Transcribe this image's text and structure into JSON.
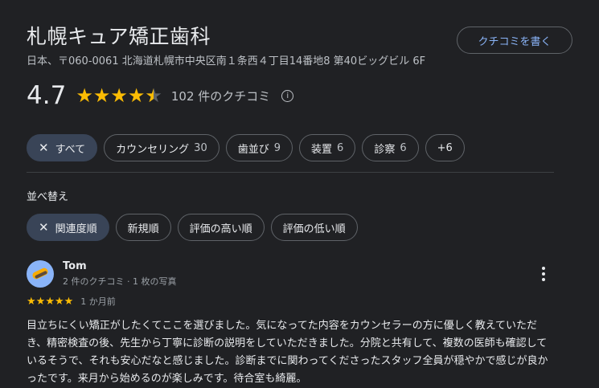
{
  "place": {
    "name": "札幌キュア矯正歯科",
    "address": "日本、〒060-0061 北海道札幌市中央区南１条西４丁目14番地8 第40ビッグビル 6F",
    "write_review_label": "クチコミを書く"
  },
  "summary": {
    "rating": "4.7",
    "stars_value": 4.7,
    "review_count_label": "102 件のクチコミ"
  },
  "filters": [
    {
      "label": "すべて",
      "count": "",
      "active": true
    },
    {
      "label": "カウンセリング",
      "count": "30",
      "active": false
    },
    {
      "label": "歯並び",
      "count": "9",
      "active": false
    },
    {
      "label": "装置",
      "count": "6",
      "active": false
    },
    {
      "label": "診察",
      "count": "6",
      "active": false
    },
    {
      "label": "+6",
      "count": "",
      "active": false
    }
  ],
  "sort": {
    "label": "並べ替え",
    "options": [
      {
        "label": "関連度順",
        "active": true
      },
      {
        "label": "新規順",
        "active": false
      },
      {
        "label": "評価の高い順",
        "active": false
      },
      {
        "label": "評価の低い順",
        "active": false
      }
    ]
  },
  "review": {
    "author": "Tom",
    "meta": "2 件のクチコミ · 1 枚の写真",
    "stars_value": 5,
    "time": "1 か月前",
    "text": "目立ちにくい矯正がしたくてここを選びました。気になってた内容をカウンセラーの方に優しく教えていただき、精密検査の後、先生から丁寧に診断の説明をしていただきました。分院と共有して、複数の医師も確認しているそうで、それも安心だなと感じました。診断までに関わってくださったスタッフ全員が穏やかで感じが良かったです。来月から始めるのが楽しみです。待合室も綺麗。"
  },
  "colors": {
    "background": "#202124",
    "star": "#fbbc04",
    "accent_link": "#8ab4f8",
    "active_chip": "#394457"
  }
}
